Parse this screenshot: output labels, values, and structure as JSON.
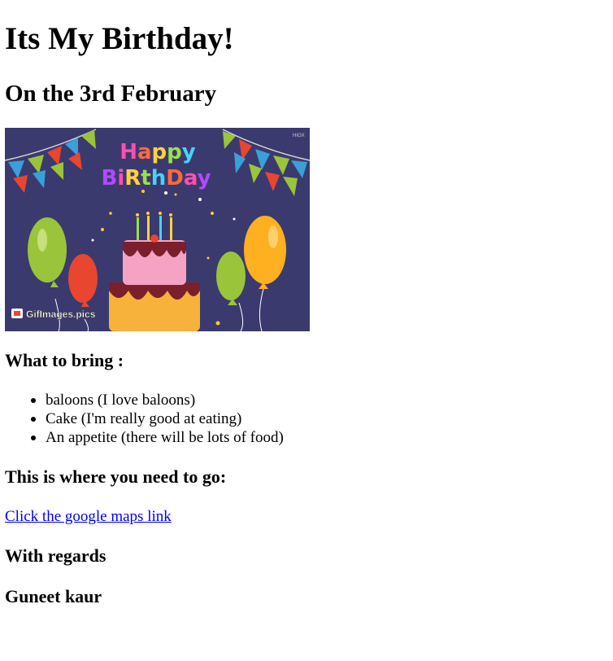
{
  "header": {
    "title": "Its My Birthday!",
    "date_line": "On the 3rd February"
  },
  "banner": {
    "headline": "HappyBirthDay",
    "watermark": "GifImages.pics",
    "corner_mark": "HIOX",
    "background_color": "#3b3a6e"
  },
  "bring": {
    "heading": "What to bring :",
    "items": [
      "baloons (I love baloons)",
      "Cake (I'm really good at eating)",
      "An appetite (there will be lots of food)"
    ]
  },
  "location": {
    "heading": "This is where you need to go:",
    "link_text": "Click the google maps link",
    "link_color": "#0000ee"
  },
  "closing": {
    "regards": "With regards",
    "name": "Guneet kaur"
  }
}
